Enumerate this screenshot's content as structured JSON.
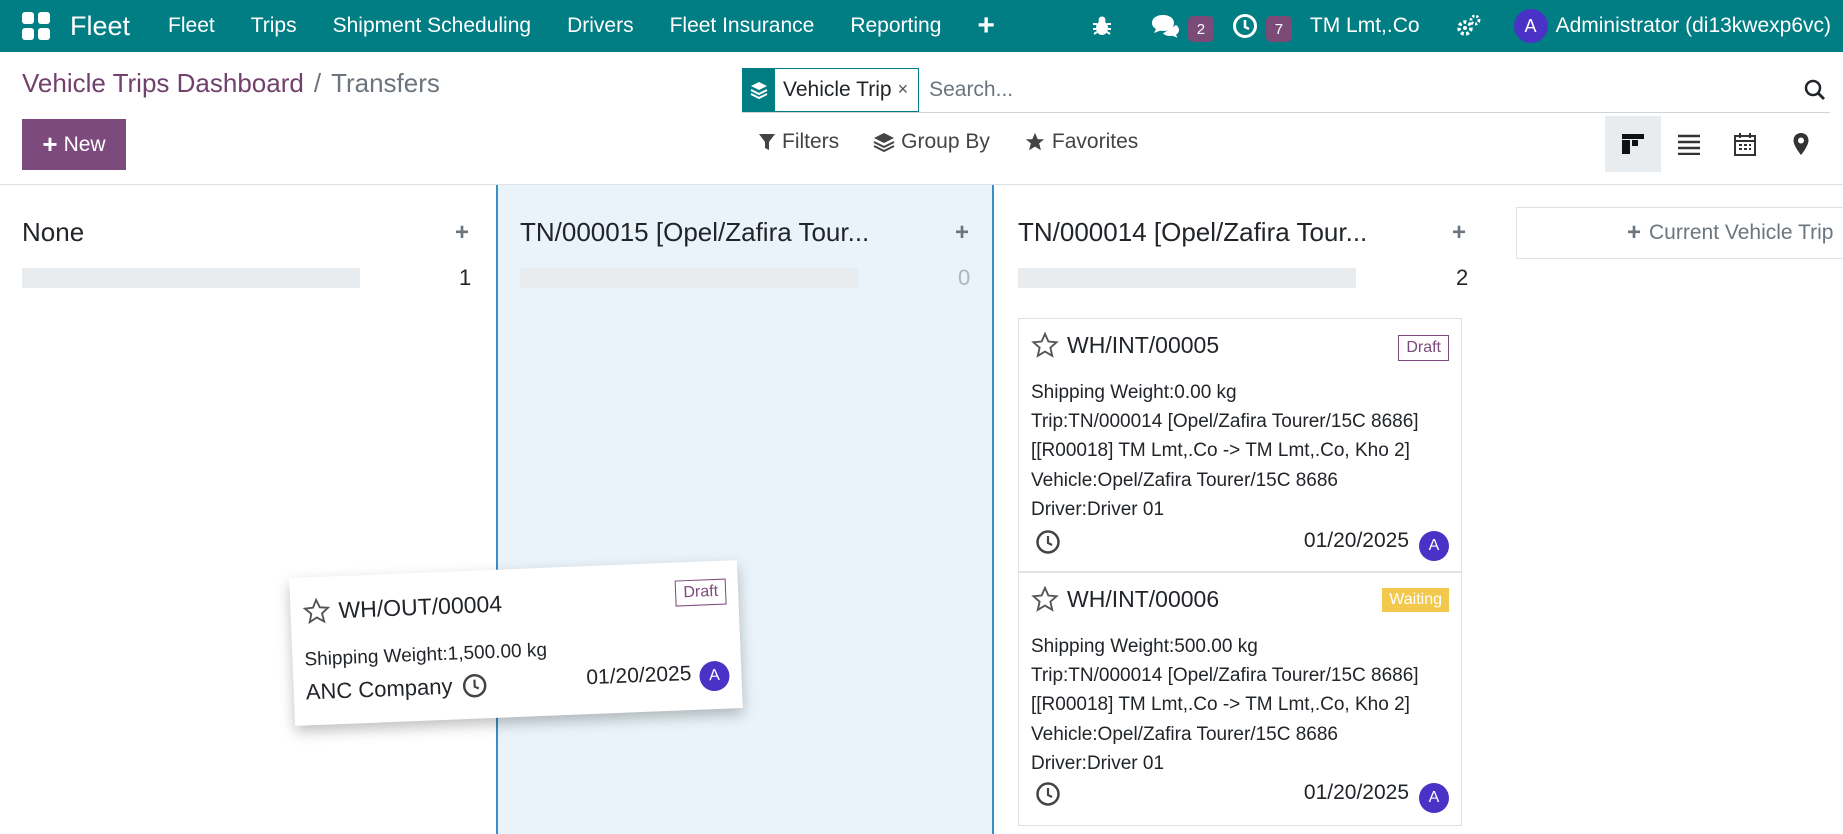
{
  "navbar": {
    "app_name": "Fleet",
    "menu": [
      "Fleet",
      "Trips",
      "Shipment Scheduling",
      "Drivers",
      "Fleet Insurance",
      "Reporting"
    ],
    "messages_count": "2",
    "activities_count": "7",
    "company": "TM Lmt,.Co",
    "user_initial": "A",
    "user_name": "Administrator (di13kwexp6vc)"
  },
  "breadcrumb": {
    "parent": "Vehicle Trips Dashboard",
    "separator": "/",
    "current": "Transfers"
  },
  "new_button": "New",
  "search": {
    "facet_label": "Vehicle Trip",
    "facet_remove": "×",
    "placeholder": "Search..."
  },
  "filters": {
    "filters_label": "Filters",
    "group_by_label": "Group By",
    "favorites_label": "Favorites"
  },
  "columns": [
    {
      "title": "None",
      "count": "1"
    },
    {
      "title": "TN/000015 [Opel/Zafira Tour...",
      "count": "0"
    },
    {
      "title": "TN/000014 [Opel/Zafira Tour...",
      "count": "2"
    }
  ],
  "add_column_label": "Current Vehicle Trip",
  "dragged_card": {
    "name": "WH/OUT/00004",
    "status": "Draft",
    "weight": "Shipping Weight:1,500.00 kg",
    "partner": "ANC Company",
    "date": "01/20/2025",
    "avatar": "A"
  },
  "cards": [
    {
      "name": "WH/INT/00005",
      "status": "Draft",
      "weight": "Shipping Weight:0.00 kg",
      "trip": "Trip:TN/000014 [Opel/Zafira Tourer/15C 8686]",
      "route": "[[R00018] TM Lmt,.Co -> TM Lmt,.Co, Kho 2]",
      "vehicle": "Vehicle:Opel/Zafira Tourer/15C 8686",
      "driver": "Driver:Driver 01",
      "date": "01/20/2025",
      "avatar": "A"
    },
    {
      "name": "WH/INT/00006",
      "status": "Waiting",
      "weight": "Shipping Weight:500.00 kg",
      "trip": "Trip:TN/000014 [Opel/Zafira Tourer/15C 8686]",
      "route": "[[R00018] TM Lmt,.Co -> TM Lmt,.Co, Kho 2]",
      "vehicle": "Vehicle:Opel/Zafira Tourer/15C 8686",
      "driver": "Driver:Driver 01",
      "date": "01/20/2025",
      "avatar": "A"
    }
  ]
}
